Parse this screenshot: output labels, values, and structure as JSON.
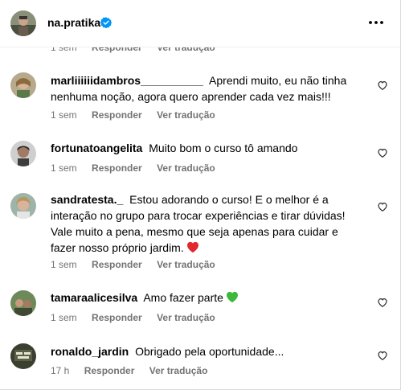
{
  "header": {
    "username": "na.pratika",
    "verified": true,
    "more_icon": "more-horizontal-icon"
  },
  "peek": {
    "time": "1 sem",
    "reply": "Responder",
    "translate": "Ver tradução"
  },
  "comments": [
    {
      "username": "marliiiiiidambros__________",
      "text": "Aprendi muito, eu não tinha nenhuma noção, agora quero aprender cada vez mais!!!",
      "time": "1 sem",
      "reply": "Responder",
      "translate": "Ver tradução"
    },
    {
      "username": "fortunatoangelita",
      "text": "Muito bom o curso tô amando",
      "time": "1 sem",
      "reply": "Responder",
      "translate": "Ver tradução"
    },
    {
      "username": "sandratesta._",
      "text": "Estou adorando o curso! E o melhor é a interação no grupo para trocar experiências e tirar dúvidas! Vale muito a pena, mesmo que seja apenas para cuidar e fazer nosso próprio jardim.",
      "emoji": "red-heart",
      "time": "1 sem",
      "reply": "Responder",
      "translate": "Ver tradução"
    },
    {
      "username": "tamaraalicesilva",
      "text": "Amo fazer parte",
      "emoji": "green-heart",
      "time": "1 sem",
      "reply": "Responder",
      "translate": "Ver tradução"
    },
    {
      "username": "ronaldo_jardin",
      "text": "Obrigado pela oportunidade...",
      "time": "17 h",
      "reply": "Responder",
      "translate": "Ver tradução"
    }
  ],
  "colors": {
    "verified_blue": "#0095f6",
    "meta_gray": "#737373",
    "red_heart": "#e0282e",
    "green_heart": "#3cb83c"
  }
}
